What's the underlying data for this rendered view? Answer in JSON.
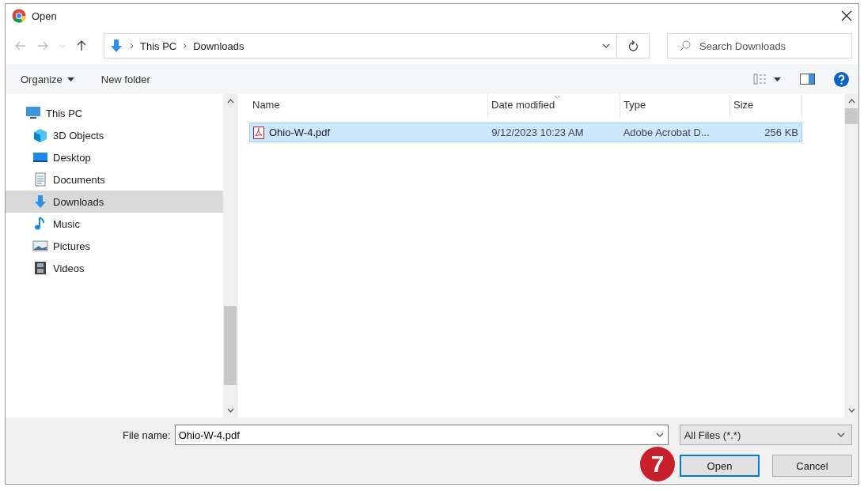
{
  "window": {
    "title": "Open"
  },
  "address": {
    "path": [
      "This PC",
      "Downloads"
    ]
  },
  "search": {
    "placeholder": "Search Downloads"
  },
  "toolbar": {
    "organize": "Organize",
    "new_folder": "New folder"
  },
  "sidebar": {
    "items": [
      {
        "label": "This PC",
        "kind": "pc",
        "selected": false,
        "children": [
          {
            "label": "3D Objects",
            "kind": "cube",
            "selected": false
          },
          {
            "label": "Desktop",
            "kind": "desktop",
            "selected": false
          },
          {
            "label": "Documents",
            "kind": "documents",
            "selected": false
          },
          {
            "label": "Downloads",
            "kind": "downloads",
            "selected": true
          },
          {
            "label": "Music",
            "kind": "music",
            "selected": false
          },
          {
            "label": "Pictures",
            "kind": "pictures",
            "selected": false
          },
          {
            "label": "Videos",
            "kind": "videos",
            "selected": false
          }
        ]
      }
    ]
  },
  "table": {
    "columns": [
      {
        "label": "Name",
        "sorted": false
      },
      {
        "label": "Date modified",
        "sorted": true
      },
      {
        "label": "Type",
        "sorted": false
      },
      {
        "label": "Size",
        "sorted": false
      }
    ],
    "rows": [
      {
        "name": "Ohio-W-4.pdf",
        "date": "9/12/2023 10:23 AM",
        "type": "Adobe Acrobat D...",
        "size": "256 KB",
        "selected": true
      }
    ]
  },
  "file_name": {
    "label": "File name:",
    "value": "Ohio-W-4.pdf"
  },
  "file_type": {
    "value": "All Files (*.*)"
  },
  "step_badge": "7",
  "buttons": [
    {
      "label": "Open",
      "default": true
    },
    {
      "label": "Cancel",
      "default": false
    }
  ]
}
